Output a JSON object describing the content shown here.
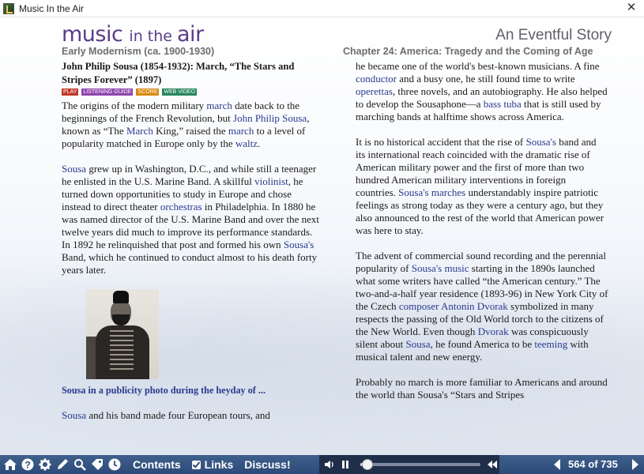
{
  "window": {
    "title": "Music In the Air",
    "close_glyph": "✕"
  },
  "header": {
    "logo_big_1": "music ",
    "logo_small": "in the ",
    "logo_big_2": "air",
    "story_title": "An Eventful Story",
    "era": "Early Modernism (ca. 1900-1930)",
    "chapter": "Chapter 24: America:  Tragedy and the Coming of Age"
  },
  "left": {
    "piece_title": "John Philip Sousa (1854-1932): March, “The Stars and Stripes Forever” (1897)",
    "badges": [
      {
        "label": "PLAY",
        "color": "#c0392b"
      },
      {
        "label": "LISTENING GUIDE",
        "color": "#8e44ad"
      },
      {
        "label": "SCORE",
        "color": "#d68910"
      },
      {
        "label": "WEB VIDEO",
        "color": "#27865a"
      }
    ],
    "p1": [
      {
        "t": "The origins of the modern military "
      },
      {
        "t": "march",
        "link": true
      },
      {
        "t": " date back to the beginnings of the French Revolution, but "
      },
      {
        "t": "John Philip Sousa",
        "link": true
      },
      {
        "t": ", known as “The "
      },
      {
        "t": "March",
        "link": true
      },
      {
        "t": " King,” raised the "
      },
      {
        "t": "march",
        "link": true
      },
      {
        "t": " to a level of popularity matched in Europe only by the "
      },
      {
        "t": "waltz",
        "link": true
      },
      {
        "t": "."
      }
    ],
    "p2": [
      {
        "t": "Sousa",
        "link": true
      },
      {
        "t": " grew up in Washington, D.C., and while still a teenager he enlisted in the U.S. Marine Band. A skillful "
      },
      {
        "t": "violinist",
        "link": true
      },
      {
        "t": ", he turned down opportunities to study in Europe and chose instead to direct theater "
      },
      {
        "t": "orchestras",
        "link": true
      },
      {
        "t": " in Philadelphia. In 1880 he was named director of the U.S. Marine Band and over the next twelve years did much to improve its performance standards. In 1892 he relinquished that post and formed his own "
      },
      {
        "t": "Sousa's",
        "link": true
      },
      {
        "t": " Band, which he continued to conduct almost to his death forty years later."
      }
    ],
    "caption": "Sousa in a publicity photo during the heyday of ...",
    "p3": [
      {
        "t": "Sousa",
        "link": true
      },
      {
        "t": " and his band made four European tours, and"
      }
    ]
  },
  "right": {
    "p1": [
      {
        "t": "he became one of the world's best-known musicians. A fine "
      },
      {
        "t": "conductor",
        "link": true
      },
      {
        "t": " and a busy one, he still found time to write "
      },
      {
        "t": "operettas",
        "link": true
      },
      {
        "t": ", three novels, and an autobiography. He also helped to develop the Sousaphone—a "
      },
      {
        "t": "bass tuba",
        "link": true
      },
      {
        "t": " that is still used by marching bands at halftime shows across America."
      }
    ],
    "p2": [
      {
        "t": "It is no historical accident that the rise of "
      },
      {
        "t": "Sousa's",
        "link": true
      },
      {
        "t": " band and its international reach coincided with the dramatic rise of American military power and the first of more than two hundred American military interventions in foreign countries. "
      },
      {
        "t": "Sousa's marches",
        "link": true
      },
      {
        "t": " understandably inspire patriotic feelings as strong today as they were a century ago, but they also announced to the rest of the world that American power was here to stay."
      }
    ],
    "p3": [
      {
        "t": "The advent of commercial sound recording and the perennial popularity of "
      },
      {
        "t": "Sousa's music",
        "link": true
      },
      {
        "t": " starting in the 1890s launched what some writers have called “the American century.” The two-and-a-half year residence (1893-96) in New York City of the Czech "
      },
      {
        "t": "composer Antonin Dvorak",
        "link": true
      },
      {
        "t": " symbolized in many respects the passing of the Old World torch to the citizens of the New World. Even though "
      },
      {
        "t": "Dvorak",
        "link": true
      },
      {
        "t": " was conspicuously silent about "
      },
      {
        "t": "Sousa",
        "link": true
      },
      {
        "t": ", he found America to be "
      },
      {
        "t": "teeming",
        "link": true
      },
      {
        "t": " with musical talent and new energy."
      }
    ],
    "p4": [
      {
        "t": "Probably no march is more familiar to Americans and around the world than Sousa's “Stars and Stripes"
      }
    ]
  },
  "toolbar": {
    "icons": [
      "home-icon",
      "help-icon",
      "settings-icon",
      "pen-icon",
      "search-icon",
      "bookmark-icon",
      "history-icon"
    ],
    "contents_label": "Contents",
    "links_label": "Links",
    "links_checked": true,
    "discuss_label": "Discuss!",
    "player_progress": 0.06,
    "page_current": "564",
    "page_total": "735",
    "page_label": "564 of 735",
    "colors": {
      "toolbar": "#2c4a78",
      "player": "#1f2f49",
      "link": "#2a3a8f",
      "logo": "#5a3d8a"
    }
  }
}
